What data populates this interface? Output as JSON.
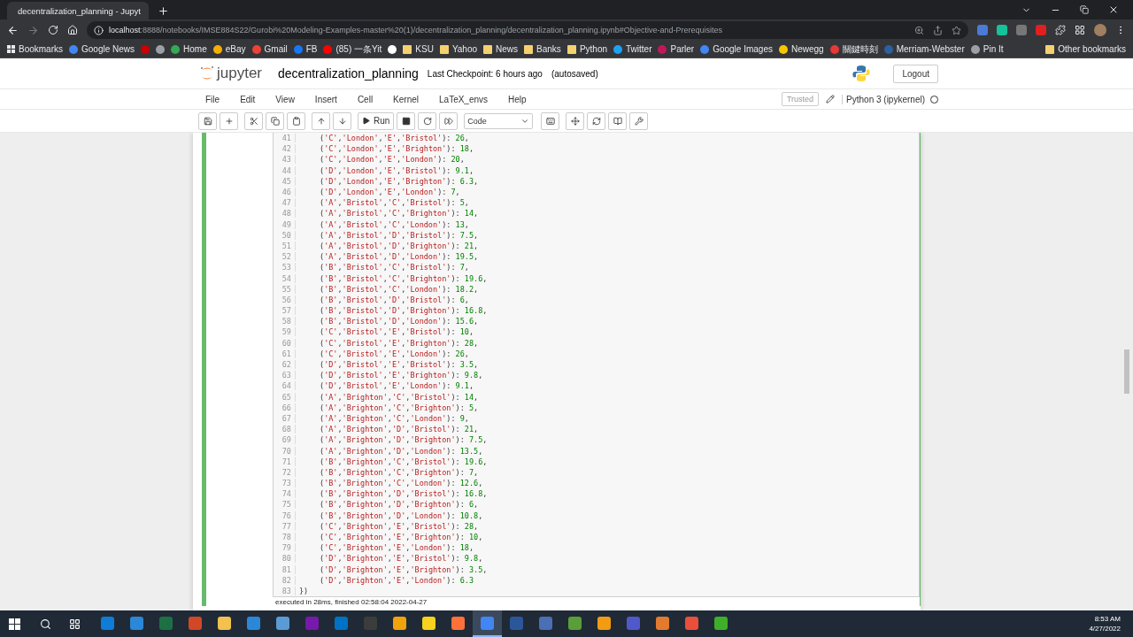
{
  "browser": {
    "tab": {
      "title": "decentralization_planning - Jupyt",
      "selected": true
    },
    "url": {
      "host": "localhost",
      "rest": ":8888/notebooks/IMSE884S22/Gurobi%20Modeling-Examples-master%20(1)/decentralization_planning/decentralization_planning.ipynb#Objective-and-Prerequisites"
    },
    "bookmarks": [
      {
        "label": "Bookmarks",
        "kind": "menu"
      },
      {
        "label": "Google News",
        "kind": "site",
        "color": "#4285f4"
      },
      {
        "kind": "site",
        "color": "#cc0000"
      },
      {
        "kind": "site",
        "color": "#9aa0a6"
      },
      {
        "label": "Home",
        "kind": "site",
        "color": "#34a853"
      },
      {
        "label": "eBay",
        "kind": "site",
        "color": "#f5af02"
      },
      {
        "label": "Gmail",
        "kind": "site",
        "color": "#ea4335"
      },
      {
        "label": "FB",
        "kind": "site",
        "color": "#1877f2"
      },
      {
        "label": "(85) 一条Yit",
        "kind": "site",
        "color": "#ff0000"
      },
      {
        "kind": "site",
        "color": "#ffffff"
      },
      {
        "label": "KSU",
        "kind": "folder",
        "color": "#f4d06f"
      },
      {
        "label": "Yahoo",
        "kind": "folder",
        "color": "#f4d06f"
      },
      {
        "label": "News",
        "kind": "folder",
        "color": "#f4d06f"
      },
      {
        "label": "Banks",
        "kind": "folder",
        "color": "#f4d06f"
      },
      {
        "label": "Python",
        "kind": "folder",
        "color": "#f4d06f"
      },
      {
        "label": "Twitter",
        "kind": "site",
        "color": "#1da1f2"
      },
      {
        "label": "Parler",
        "kind": "site",
        "color": "#c2185b"
      },
      {
        "label": "Google Images",
        "kind": "site",
        "color": "#4285f4"
      },
      {
        "label": "Newegg",
        "kind": "site",
        "color": "#f7c600"
      },
      {
        "label": "關鍵時刻",
        "kind": "site",
        "color": "#e53935"
      },
      {
        "label": "Merriam-Webster",
        "kind": "site",
        "color": "#2e5f9e"
      },
      {
        "label": "Pin It",
        "kind": "site",
        "color": "#9aa0a6"
      }
    ],
    "other_bookmarks": "Other bookmarks"
  },
  "jupyter": {
    "logo_text": "jupyter",
    "notebook_name": "decentralization_planning",
    "checkpoint": "Last Checkpoint: 6 hours ago",
    "autosave": "(autosaved)",
    "logout": "Logout",
    "menu": [
      "File",
      "Edit",
      "View",
      "Insert",
      "Cell",
      "Kernel",
      "LaTeX_envs",
      "Help"
    ],
    "trusted": "Trusted",
    "kernel": "Python 3 (ipykernel)",
    "kernel_busy": false,
    "toolbar": [
      {
        "kind": "save"
      },
      {
        "kind": "add"
      },
      {
        "kind": "cut"
      },
      {
        "kind": "copy"
      },
      {
        "kind": "paste"
      },
      {
        "kind": "up"
      },
      {
        "kind": "down"
      },
      {
        "kind": "run",
        "label": "Run"
      },
      {
        "kind": "stop"
      },
      {
        "kind": "restart"
      },
      {
        "kind": "restart-run"
      },
      {
        "kind": "select",
        "value": "Code"
      },
      {
        "kind": "keyboard"
      },
      {
        "kind": "move"
      },
      {
        "kind": "refresh"
      },
      {
        "kind": "book"
      },
      {
        "kind": "wrench"
      }
    ]
  },
  "cell": {
    "selected": true,
    "lines": [
      {
        "number": "41",
        "kind": "entry",
        "text": "('C','London','E','Bristol'): 26,"
      },
      {
        "number": "42",
        "kind": "entry",
        "text": "('C','London','E','Brighton'): 18,"
      },
      {
        "number": "43",
        "kind": "entry",
        "text": "('C','London','E','London'): 20,"
      },
      {
        "number": "44",
        "kind": "entry",
        "text": "('D','London','E','Bristol'): 9.1,"
      },
      {
        "number": "45",
        "kind": "entry",
        "text": "('D','London','E','Brighton'): 6.3,"
      },
      {
        "number": "46",
        "kind": "entry",
        "text": "('D','London','E','London'): 7,"
      },
      {
        "number": "47",
        "kind": "entry",
        "text": "('A','Bristol','C','Bristol'): 5,"
      },
      {
        "number": "48",
        "kind": "entry",
        "text": "('A','Bristol','C','Brighton'): 14,"
      },
      {
        "number": "49",
        "kind": "entry",
        "text": "('A','Bristol','C','London'): 13,"
      },
      {
        "number": "50",
        "kind": "entry",
        "text": "('A','Bristol','D','Bristol'): 7.5,"
      },
      {
        "number": "51",
        "kind": "entry",
        "text": "('A','Bristol','D','Brighton'): 21,"
      },
      {
        "number": "52",
        "kind": "entry",
        "text": "('A','Bristol','D','London'): 19.5,"
      },
      {
        "number": "53",
        "kind": "entry",
        "text": "('B','Bristol','C','Bristol'): 7,"
      },
      {
        "number": "54",
        "kind": "entry",
        "text": "('B','Bristol','C','Brighton'): 19.6,"
      },
      {
        "number": "55",
        "kind": "entry",
        "text": "('B','Bristol','C','London'): 18.2,"
      },
      {
        "number": "56",
        "kind": "entry",
        "text": "('B','Bristol','D','Bristol'): 6,"
      },
      {
        "number": "57",
        "kind": "entry",
        "text": "('B','Bristol','D','Brighton'): 16.8,"
      },
      {
        "number": "58",
        "kind": "entry",
        "text": "('B','Bristol','D','London'): 15.6,"
      },
      {
        "number": "59",
        "kind": "entry",
        "text": "('C','Bristol','E','Bristol'): 10,"
      },
      {
        "number": "60",
        "kind": "entry",
        "text": "('C','Bristol','E','Brighton'): 28,"
      },
      {
        "number": "61",
        "kind": "entry",
        "text": "('C','Bristol','E','London'): 26,"
      },
      {
        "number": "62",
        "kind": "entry",
        "text": "('D','Bristol','E','Bristol'): 3.5,"
      },
      {
        "number": "63",
        "kind": "entry",
        "text": "('D','Bristol','E','Brighton'): 9.8,"
      },
      {
        "number": "64",
        "kind": "entry",
        "text": "('D','Bristol','E','London'): 9.1,"
      },
      {
        "number": "65",
        "kind": "entry",
        "text": "('A','Brighton','C','Bristol'): 14,"
      },
      {
        "number": "66",
        "kind": "entry",
        "text": "('A','Brighton','C','Brighton'): 5,"
      },
      {
        "number": "67",
        "kind": "entry",
        "text": "('A','Brighton','C','London'): 9,"
      },
      {
        "number": "68",
        "kind": "entry",
        "text": "('A','Brighton','D','Bristol'): 21,"
      },
      {
        "number": "69",
        "kind": "entry",
        "text": "('A','Brighton','D','Brighton'): 7.5,"
      },
      {
        "number": "70",
        "kind": "entry",
        "text": "('A','Brighton','D','London'): 13.5,"
      },
      {
        "number": "71",
        "kind": "entry",
        "text": "('B','Brighton','C','Bristol'): 19.6,"
      },
      {
        "number": "72",
        "kind": "entry",
        "text": "('B','Brighton','C','Brighton'): 7,"
      },
      {
        "number": "73",
        "kind": "entry",
        "text": "('B','Brighton','C','London'): 12.6,"
      },
      {
        "number": "74",
        "kind": "entry",
        "text": "('B','Brighton','D','Bristol'): 16.8,"
      },
      {
        "number": "75",
        "kind": "entry",
        "text": "('B','Brighton','D','Brighton'): 6,"
      },
      {
        "number": "76",
        "kind": "entry",
        "text": "('B','Brighton','D','London'): 10.8,"
      },
      {
        "number": "77",
        "kind": "entry",
        "text": "('C','Brighton','E','Bristol'): 28,"
      },
      {
        "number": "78",
        "kind": "entry",
        "text": "('C','Brighton','E','Brighton'): 10,"
      },
      {
        "number": "79",
        "kind": "entry",
        "text": "('C','Brighton','E','London'): 18,"
      },
      {
        "number": "80",
        "kind": "entry",
        "text": "('D','Brighton','E','Bristol'): 9.8,"
      },
      {
        "number": "81",
        "kind": "entry",
        "text": "('D','Brighton','E','Brighton'): 3.5,"
      },
      {
        "number": "82",
        "kind": "entry",
        "text": "('D','Brighton','E','London'): 6.3"
      },
      {
        "number": "83",
        "kind": "close",
        "text": "})"
      }
    ],
    "execution_note": "executed in 28ms, finished 02:58:04 2022-04-27"
  },
  "taskbar": {
    "apps": [
      {
        "color": "#0f7cd8",
        "selected": false
      },
      {
        "color": "#2b88d8",
        "selected": false
      },
      {
        "color": "#1d7044",
        "selected": false
      },
      {
        "color": "#d24726",
        "selected": false
      },
      {
        "color": "#f2c14e",
        "selected": false
      },
      {
        "color": "#2b88d8",
        "selected": false
      },
      {
        "color": "#5b9bd5",
        "selected": false
      },
      {
        "color": "#7719aa",
        "selected": false
      },
      {
        "color": "#0072c6",
        "selected": false
      },
      {
        "color": "#3c3c3c",
        "selected": false
      },
      {
        "color": "#f0a30a",
        "selected": false
      },
      {
        "color": "#f7d21e",
        "selected": false
      },
      {
        "color": "#ff7139",
        "selected": false
      },
      {
        "color": "#4285f4",
        "selected": true
      },
      {
        "color": "#2b579a",
        "selected": false
      },
      {
        "color": "#4a6fb5",
        "selected": false
      },
      {
        "color": "#5a9e3a",
        "selected": false
      },
      {
        "color": "#f39c12",
        "selected": false
      },
      {
        "color": "#5059c9",
        "selected": false
      },
      {
        "color": "#e37a2e",
        "selected": false
      },
      {
        "color": "#e94f3a",
        "selected": false
      },
      {
        "color": "#3fae29",
        "selected": false
      }
    ],
    "time": "8:53 AM",
    "date": "4/27/2022"
  }
}
